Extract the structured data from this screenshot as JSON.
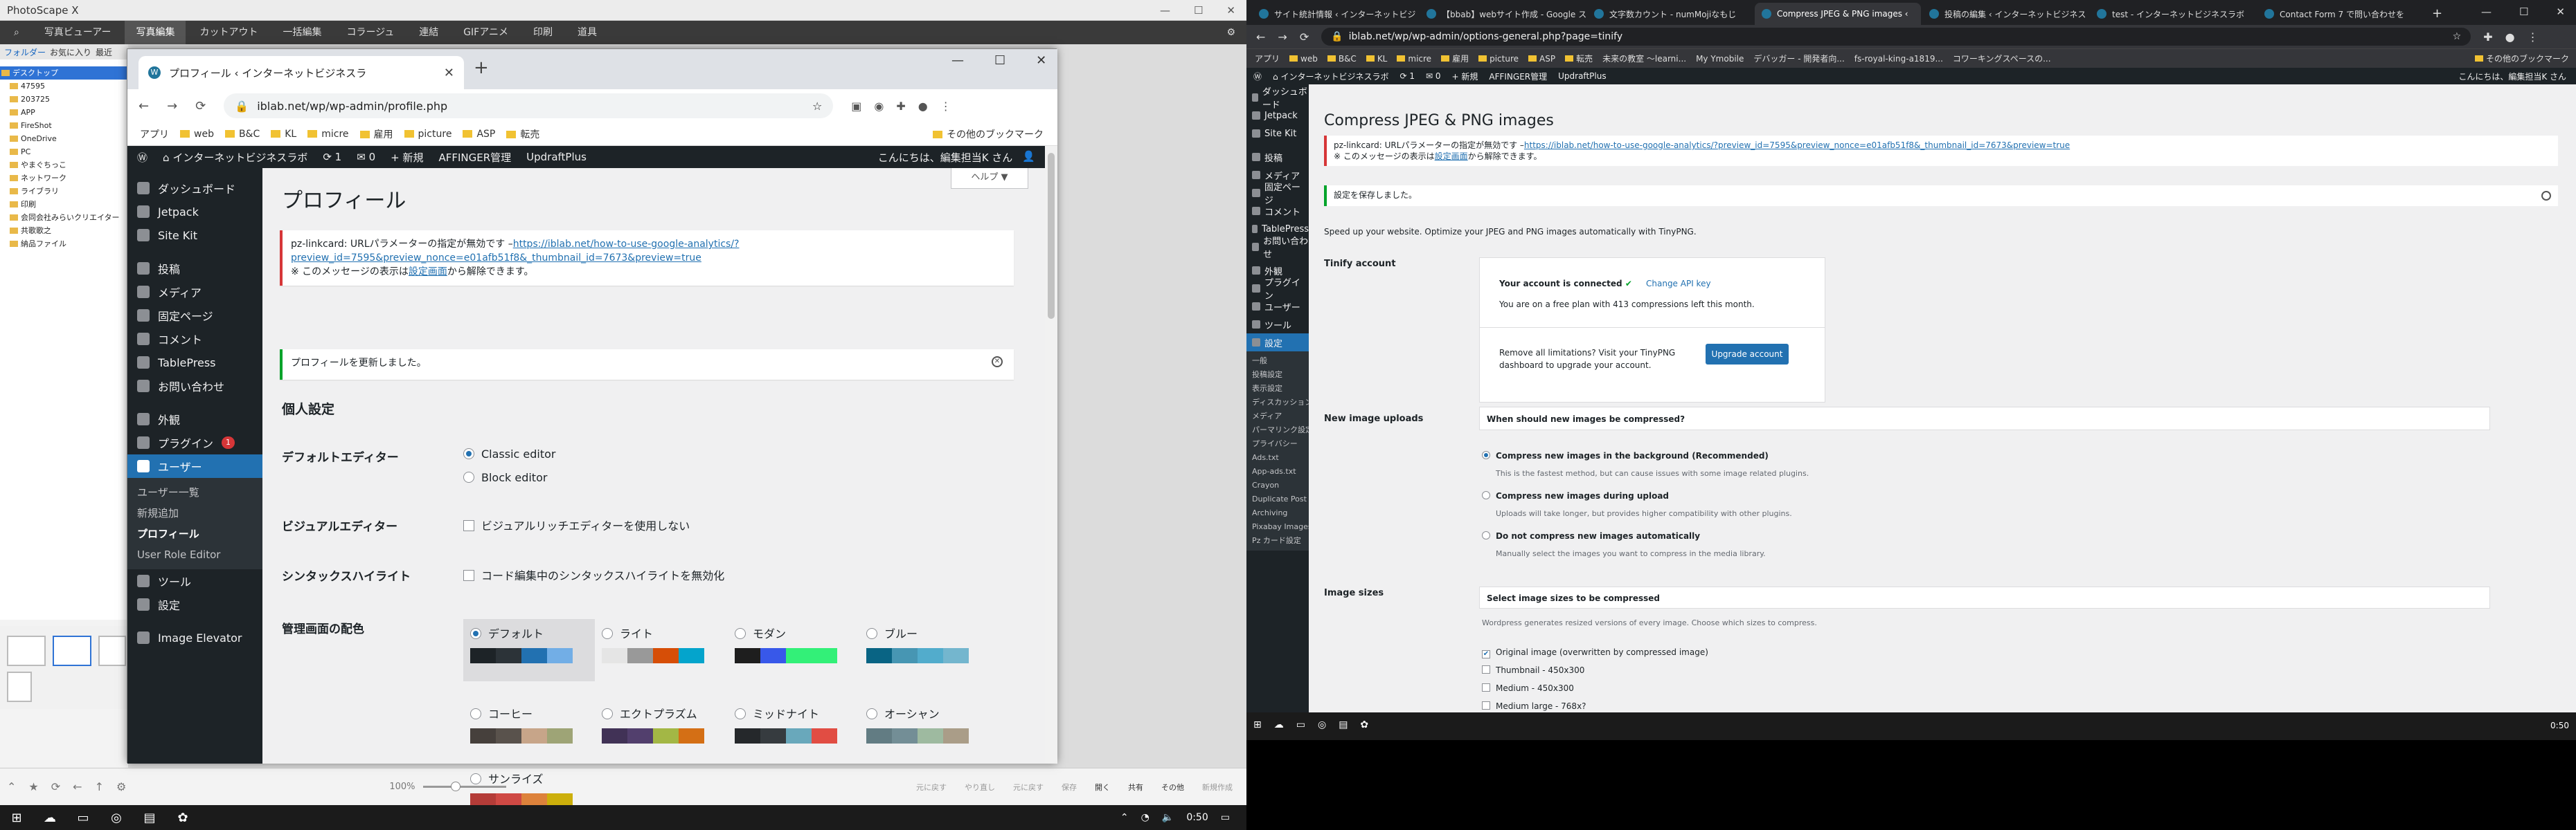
{
  "photoscape": {
    "title": "PhotoScape X",
    "menu_tabs": [
      "写真ビューアー",
      "写真編集",
      "カットアウト",
      "一括編集",
      "コラージュ",
      "連結",
      "GIFアニメ",
      "印刷",
      "道具"
    ],
    "active_tab": 1,
    "sub_tabs": [
      "フォルダー",
      "お気に入り",
      "最近"
    ],
    "tree": [
      "デスクトップ",
      "47595",
      "203725",
      "APP",
      "FireShot",
      "OneDrive",
      "PC",
      "やまぐちっこ",
      "ネットワーク",
      "ライブラリ",
      "印刷",
      "会同会社みらいクリエイター",
      "共歌歌之",
      "納品ファイル"
    ],
    "zoom_label": "100%",
    "actions": [
      "元に戻す",
      "やり直し",
      "元に戻す",
      "保存",
      "開く",
      "共有",
      "その他",
      "新規作成"
    ]
  },
  "taskbar_left": {
    "time": "0:50"
  },
  "popup": {
    "tab_title": "プロフィール ‹ インターネットビジネスラ",
    "url": "iblab.net/wp/wp-admin/profile.php",
    "bookmarks": [
      "アプリ",
      "web",
      "B&C",
      "KL",
      "micre",
      "雇用",
      "picture",
      "ASP",
      "転売"
    ],
    "bookmarks_more": "その他のブックマーク",
    "adminbar": {
      "site": "インターネットビジネスラボ",
      "updates": "1",
      "comments": "0",
      "new": "+ 新規",
      "affinger": "AFFINGER管理",
      "updraft": "UpdraftPlus",
      "greeting": "こんにちは、編集担当K さん"
    },
    "menu": [
      "ダッシュボード",
      "Jetpack",
      "Site Kit",
      "投稿",
      "メディア",
      "固定ページ",
      "コメント",
      "TablePress",
      "お問い合わせ",
      "外観",
      "プラグイン",
      "ユーザー",
      "ツール",
      "設定",
      "Image Elevator"
    ],
    "plugin_badge": "1",
    "user_sub": [
      "ユーザー一覧",
      "新規追加",
      "プロフィール",
      "User Role Editor"
    ],
    "help": "ヘルプ ▼",
    "page_title": "プロフィール",
    "notice_error_prefix": "pz-linkcard: URLパラメーターの指定が無効です –",
    "notice_error_link": "https://iblab.net/how-to-use-google-analytics/?preview_id=7595&preview_nonce=e01afb51f8&_thumbnail_id=7673&preview=true",
    "notice_error_note_a": "※ このメッセージの表示は",
    "notice_error_note_link": "設定画面",
    "notice_error_note_b": "から解除できます。",
    "notice_success": "プロフィールを更新しました。",
    "section": "個人設定",
    "editor_label": "デフォルトエディター",
    "editor_opt1": "Classic editor",
    "editor_opt2": "Block editor",
    "visual_label": "ビジュアルエディター",
    "visual_opt": "ビジュアルリッチエディターを使用しない",
    "syntax_label": "シンタックスハイライト",
    "syntax_opt": "コード編集中のシンタックスハイライトを無効化",
    "color_label": "管理画面の配色",
    "schemes": [
      {
        "name": "デフォルト",
        "colors": [
          "#1d2327",
          "#2c3338",
          "#2271b1",
          "#72aee6"
        ],
        "selected": true
      },
      {
        "name": "ライト",
        "colors": [
          "#e5e5e5",
          "#999999",
          "#d64e07",
          "#04a4cc"
        ]
      },
      {
        "name": "モダン",
        "colors": [
          "#1e1e1e",
          "#3858e9",
          "#33f078",
          "#33f078"
        ]
      },
      {
        "name": "ブルー",
        "colors": [
          "#096484",
          "#4796b3",
          "#52accc",
          "#74b6ce"
        ]
      },
      {
        "name": "コーヒー",
        "colors": [
          "#46403c",
          "#59524c",
          "#c7a589",
          "#9ea476"
        ]
      },
      {
        "name": "エクトプラズム",
        "colors": [
          "#413256",
          "#523f6d",
          "#a3b745",
          "#d46f15"
        ]
      },
      {
        "name": "ミッドナイト",
        "colors": [
          "#25282b",
          "#363b3f",
          "#69a8bb",
          "#e14d43"
        ]
      },
      {
        "name": "オーシャン",
        "colors": [
          "#627c83",
          "#738e96",
          "#9ebaa0",
          "#aa9d88"
        ]
      },
      {
        "name": "サンライズ",
        "colors": [
          "#b43c38",
          "#cf4944",
          "#dd823b",
          "#ccaf0b"
        ]
      }
    ]
  },
  "right": {
    "tabs": [
      "サイト統計情報 ‹ インターネットビジ",
      "【bbab】webサイト作成 - Google ス",
      "文字数カウント - numMojiなもじ",
      "Compress JPEG & PNG images ‹",
      "投稿の編集 ‹ インターネットビジネス",
      "test - インターネットビジネスラボ",
      "Contact Form 7 で問い合わせを"
    ],
    "active_tab": 3,
    "url": "iblab.net/wp/wp-admin/options-general.php?page=tinify",
    "bookmarks": [
      "アプリ",
      "web",
      "B&C",
      "KL",
      "micre",
      "雇用",
      "picture",
      "ASP",
      "転売",
      "未来の教室 ～learni...",
      "My Ymobile",
      "デバッガー - 開発者向...",
      "fs-royal-king-a1819...",
      "コワーキングスペースの..."
    ],
    "bookmarks_more": "その他のブックマーク",
    "adminbar": {
      "site": "インターネットビジネスラボ",
      "updates": "1",
      "comments": "0",
      "new": "+ 新規",
      "affinger": "AFFINGER管理",
      "updraft": "UpdraftPlus",
      "greeting": "こんにちは、編集担当K さん"
    },
    "menu": [
      "ダッシュボード",
      "Jetpack",
      "Site Kit",
      "投稿",
      "メディア",
      "固定ページ",
      "コメント",
      "TablePress",
      "お問い合わせ",
      "外観",
      "プラグイン",
      "ユーザー",
      "ツール",
      "設定"
    ],
    "settings_sub": [
      "一般",
      "投稿設定",
      "表示設定",
      "ディスカッション",
      "メディア",
      "パーマリンク設定",
      "プライバシー",
      "Ads.txt",
      "App-ads.txt",
      "Crayon",
      "Duplicate Post",
      "Archiving",
      "Pixabay Images",
      "Pz カード設定"
    ],
    "page_title": "Compress JPEG & PNG images",
    "notice_error_prefix": "pz-linkcard: URLパラメーターの指定が無効です –",
    "notice_error_link": "https://iblab.net/how-to-use-google-analytics/?preview_id=7595&preview_nonce=e01afb51f8&_thumbnail_id=7673&preview=true",
    "notice_error_note_a": "※ このメッセージの表示は",
    "notice_error_note_link": "設定画面",
    "notice_error_note_b": "から解除できます。",
    "notice_success": "設定を保存しました。",
    "intro": "Speed up your website. Optimize your JPEG and PNG images automatically with TinyPNG.",
    "account_label": "Tinify account",
    "connected": "Your account is connected",
    "change_key": "Change API key",
    "plan": "You are on a free plan with 413 compressions left this month.",
    "remove_limits": "Remove all limitations? Visit your TinyPNG dashboard to upgrade your account.",
    "upgrade_btn": "Upgrade account",
    "uploads_label": "New image uploads",
    "uploads_q": "When should new images be compressed?",
    "opt1": "Compress new images in the background (Recommended)",
    "opt1_desc": "This is the fastest method, but can cause issues with some image related plugins.",
    "opt2": "Compress new images during upload",
    "opt2_desc": "Uploads will take longer, but provides higher compatibility with other plugins.",
    "opt3": "Do not compress new images automatically",
    "opt3_desc": "Manually select the images you want to compress in the media library.",
    "sizes_label": "Image sizes",
    "sizes_q": "Select image sizes to be compressed",
    "sizes_desc": "Wordpress generates resized versions of every image. Choose which sizes to compress.",
    "sizes": [
      {
        "label": "Original image (overwritten by compressed image)",
        "checked": true
      },
      {
        "label": "Thumbnail - 450x300",
        "checked": false
      },
      {
        "label": "Medium - 450x300",
        "checked": false
      },
      {
        "label": "Medium large - 768x?",
        "checked": false
      }
    ],
    "time": "0:50"
  }
}
